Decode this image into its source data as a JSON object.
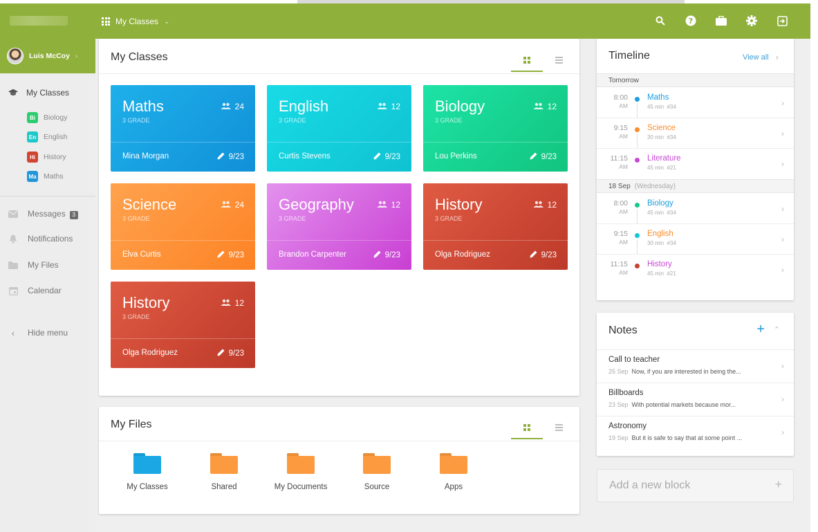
{
  "topbar": {
    "apps_label": "My Classes",
    "icons": [
      "search-icon",
      "help-icon",
      "briefcase-icon",
      "gear-icon",
      "logout-icon"
    ]
  },
  "user": {
    "name": "Luis McCoy"
  },
  "sidebar": {
    "my_classes_label": "My Classes",
    "classes": [
      {
        "badge": "Bi",
        "label": "Biology",
        "color": "#2ecc71"
      },
      {
        "badge": "En",
        "label": "English",
        "color": "#1fc8c8"
      },
      {
        "badge": "Hi",
        "label": "History",
        "color": "#d0452f"
      },
      {
        "badge": "Ma",
        "label": "Maths",
        "color": "#2196d9"
      }
    ],
    "messages_label": "Messages",
    "messages_count": "3",
    "notifications_label": "Notifications",
    "files_label": "My Files",
    "calendar_label": "Calendar",
    "hide_label": "Hide menu"
  },
  "classes_panel": {
    "title": "My Classes",
    "cards": [
      {
        "subject": "Maths",
        "grade": "3 GRADE",
        "count": "24",
        "teacher": "Mina Morgan",
        "date": "9/23",
        "colors": [
          "#1eb0ea",
          "#1190d8"
        ]
      },
      {
        "subject": "English",
        "grade": "3 GRADE",
        "count": "12",
        "teacher": "Curtis Stevens",
        "date": "9/23",
        "colors": [
          "#18dbe6",
          "#10c2d2"
        ]
      },
      {
        "subject": "Biology",
        "grade": "3 GRADE",
        "count": "12",
        "teacher": "Lou Perkins",
        "date": "9/23",
        "colors": [
          "#1de3a6",
          "#12c47e"
        ]
      },
      {
        "subject": "Science",
        "grade": "3 GRADE",
        "count": "24",
        "teacher": "Elva Curtis",
        "date": "9/23",
        "colors": [
          "#ffa24e",
          "#fd8325"
        ]
      },
      {
        "subject": "Geography",
        "grade": "3 GRADE",
        "count": "12",
        "teacher": "Brandon Carpenter",
        "date": "9/23",
        "colors": [
          "#e391ee",
          "#c93fd3"
        ]
      },
      {
        "subject": "History",
        "grade": "3 GRADE",
        "count": "12",
        "teacher": "Olga Rodriguez",
        "date": "9/23",
        "colors": [
          "#e05b43",
          "#bd3a2a"
        ]
      },
      {
        "subject": "History",
        "grade": "3 GRADE",
        "count": "12",
        "teacher": "Olga Rodriguez",
        "date": "9/23",
        "colors": [
          "#e05b43",
          "#bd3a2a"
        ]
      }
    ]
  },
  "files_panel": {
    "title": "My Files",
    "items": [
      {
        "label": "My Classes",
        "color": "#1aa7e4"
      },
      {
        "label": "Shared",
        "color": "#fb9a3e"
      },
      {
        "label": "My Documents",
        "color": "#fb9a3e"
      },
      {
        "label": "Source",
        "color": "#fb9a3e"
      },
      {
        "label": "Apps",
        "color": "#fb9a3e"
      }
    ]
  },
  "timeline": {
    "title": "Timeline",
    "view_all": "View all",
    "sections": [
      {
        "label": "Tomorrow",
        "sub": "",
        "events": [
          {
            "time": "8:00",
            "ampm": "AM",
            "name": "Maths",
            "duration": "45 min",
            "room": "#34",
            "color": "#1a9ee0"
          },
          {
            "time": "9:15",
            "ampm": "AM",
            "name": "Science",
            "duration": "30 min",
            "room": "#34",
            "color": "#fd8a2a"
          },
          {
            "time": "11:15",
            "ampm": "AM",
            "name": "Literature",
            "duration": "45 min",
            "room": "#21",
            "color": "#c846d6"
          }
        ]
      },
      {
        "label": "18 Sep",
        "sub": "(Wednesday)",
        "events": [
          {
            "time": "8:00",
            "ampm": "AM",
            "name": "Biology",
            "duration": "45 min",
            "room": "#34",
            "color": "#1a9ee0",
            "dot": "#14c890"
          },
          {
            "time": "9:15",
            "ampm": "AM",
            "name": "English",
            "duration": "30 min",
            "room": "#34",
            "color": "#fd8a2a",
            "dot": "#14c6d6"
          },
          {
            "time": "11:15",
            "ampm": "AM",
            "name": "History",
            "duration": "45 min",
            "room": "#21",
            "color": "#c846d6",
            "dot": "#c4402e"
          }
        ]
      }
    ]
  },
  "notes": {
    "title": "Notes",
    "items": [
      {
        "title": "Call to teacher",
        "date": "25 Sep",
        "text": "Now, if you are interested in being the..."
      },
      {
        "title": "Billboards",
        "date": "23 Sep",
        "text": "With potential markets because mor..."
      },
      {
        "title": "Astronomy",
        "date": "19 Sep",
        "text": "But it is safe to say that at some point ..."
      }
    ]
  },
  "add_block": {
    "label": "Add a new block"
  }
}
